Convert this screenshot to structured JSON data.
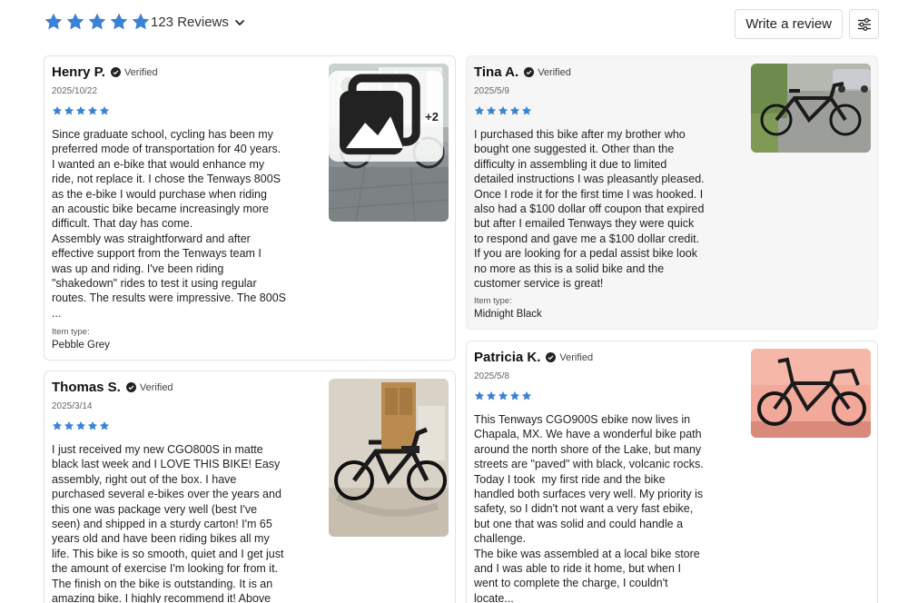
{
  "header": {
    "rating_stars": 5,
    "reviews_count": "123 Reviews",
    "write_review": "Write a review",
    "accent_color": "#3b82d6"
  },
  "reviews": [
    {
      "author": "Henry P.",
      "verified": "Verified",
      "date": "2025/10/22",
      "rating": 5,
      "body": "Since graduate school, cycling has been my\npreferred mode of transportation for 40 years.\nI wanted an e-bike that would enhance my\nride, not replace it. I chose the Tenways 800S\nas the e-bike I would purchase when riding\nan acoustic bike became increasingly more\ndifficult. That day has come.\nAssembly was straightforward and after\neffective support from the Tenways team I\nwas up and riding. I've been riding\n\"shakedown\" rides to test it using regular\nroutes. The results were impressive. The 800S\n...",
      "item_type_label": "Item type:",
      "item_type": "Pebble Grey",
      "photo_more": "+2"
    },
    {
      "author": "Tina A.",
      "verified": "Verified",
      "date": "2025/5/9",
      "rating": 5,
      "body": "I purchased this bike after my brother who\nbought one suggested it. Other than the\ndifficulty in assembling it due to limited\ndetailed instructions I was pleasantly pleased.\nOnce I rode it for the first time I was hooked. I\nalso had a $100 dollar off coupon that expired\nbut after I emailed Tenways they were quick\nto respond and gave me a $100 dollar credit.\nIf you are looking for a pedal assist bike look\nno more as this is a solid bike and the\ncustomer service is great!",
      "item_type_label": "Item type:",
      "item_type": "Midnight Black"
    },
    {
      "author": "Thomas S.",
      "verified": "Verified",
      "date": "2025/3/14",
      "rating": 5,
      "body": "I just received my new CGO800S in matte\nblack last week and I LOVE THIS BIKE! Easy\nassembly, right out of the box. I have\npurchased several e-bikes over the years and\nthis one was package very well (best I've\nseen) and shipped in a sturdy carton! I'm 65\nyears old and have been riding bikes all my\nlife. This bike is so smooth, quiet and I get just\nthe amount of exercise I'm looking for from it.\nThe finish on the bike is outstanding. It is an\namazing bike. I highly recommend it! Above"
    },
    {
      "author": "Patricia K.",
      "verified": "Verified",
      "date": "2025/5/8",
      "rating": 5,
      "body": "This Tenways CGO900S ebike now lives in\nChapala, MX. We have a wonderful bike path\naround the north shore of the Lake, but many\nstreets are \"paved\" with black, volcanic rocks.\nToday I took  my first ride and the bike\nhandled both surfaces very well. My priority is\nsafety, so I didn't not want a very fast ebike,\nbut one that was solid and could handle a\nchallenge.\nThe bike was assembled at a local bike store\nand I was able to ride it home, but when I\nwent to complete the charge, I couldn't\nlocate..."
    }
  ]
}
